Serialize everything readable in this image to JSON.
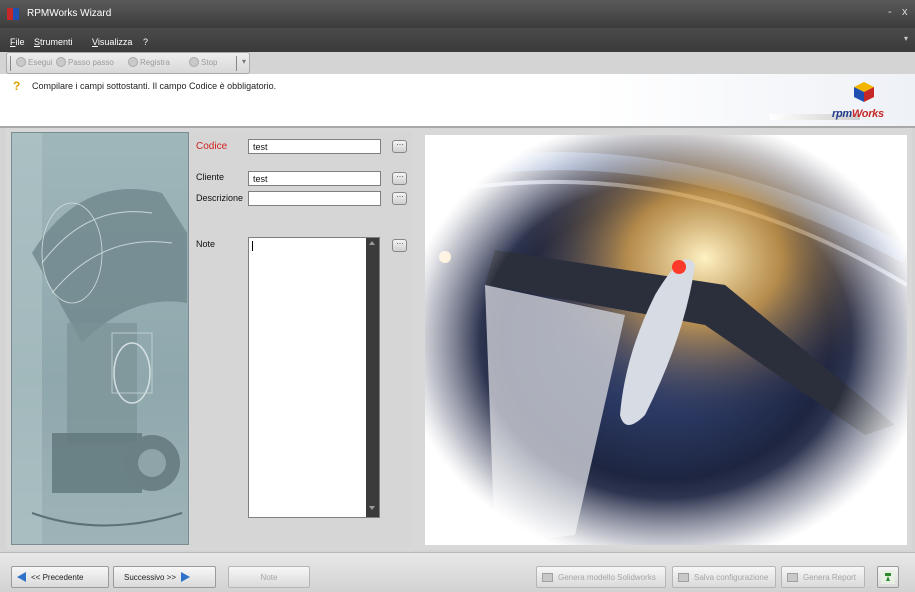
{
  "window": {
    "title": "RPMWorks Wizard",
    "minimize": "-",
    "close": "x"
  },
  "menu": [
    "File",
    "Strumenti",
    "Visualizza",
    "?"
  ],
  "toolbar": {
    "run": "Esegui",
    "step": "Passo passo",
    "record": "Registra",
    "stop": "Stop"
  },
  "banner": {
    "message": "Compilare i campi sottostanti. Il campo Codice è obbligatorio.",
    "logo_text": "rpmWorks"
  },
  "form": {
    "codice_label": "Codice",
    "codice_value": "test",
    "cliente_label": "Cliente",
    "cliente_value": "test",
    "descrizione_label": "Descrizione",
    "descrizione_value": "",
    "note_label": "Note",
    "note_value": ""
  },
  "bottom": {
    "prev": "<< Precedente",
    "next": "Successivo >>",
    "note": "Note",
    "generate_model": "Genera modello Solidworks",
    "save_config": "Salva configurazione",
    "generate_report": "Genera Report"
  },
  "colors": {
    "required_label": "#d32020",
    "accent_blue": "#2f73c9",
    "title_bar": "#4a4a4a"
  }
}
